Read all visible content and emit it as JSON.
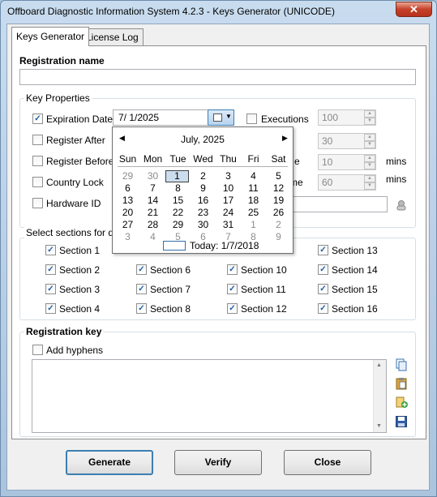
{
  "window": {
    "title": "Offboard Diagnostic Information System 4.2.3 - Keys Generator (UNICODE)",
    "close_glyph": "✕"
  },
  "tabs": [
    {
      "label": "Keys Generator",
      "selected": true
    },
    {
      "label": "License Log",
      "selected": false
    }
  ],
  "registration_name": {
    "label": "Registration name",
    "value": ""
  },
  "key_properties": {
    "title": "Key Properties",
    "expiration_date": {
      "label": "Expiration Date",
      "checked": true,
      "value": "7/  1/2025"
    },
    "register_after": {
      "label": "Register After",
      "checked": false
    },
    "register_before": {
      "label": "Register Before",
      "checked": false
    },
    "country_lock": {
      "label": "Country Lock",
      "checked": false
    },
    "hardware_id": {
      "label": "Hardware ID",
      "checked": false,
      "value": ""
    },
    "executions": {
      "label": "Executions",
      "checked": false,
      "value": "100"
    },
    "field_2": {
      "value": "30"
    },
    "field_3": {
      "partial_label": "e",
      "value": "10",
      "unit": "mins"
    },
    "field_4": {
      "partial_label": "me",
      "value": "60",
      "unit": "mins"
    }
  },
  "calendar": {
    "month_label": "July, 2025",
    "prev_glyph": "◀",
    "next_glyph": "▶",
    "days_of_week": [
      "Sun",
      "Mon",
      "Tue",
      "Wed",
      "Thu",
      "Fri",
      "Sat"
    ],
    "weeks": [
      [
        "29",
        "30",
        "1",
        "2",
        "3",
        "4",
        "5"
      ],
      [
        "6",
        "7",
        "8",
        "9",
        "10",
        "11",
        "12"
      ],
      [
        "13",
        "14",
        "15",
        "16",
        "17",
        "18",
        "19"
      ],
      [
        "20",
        "21",
        "22",
        "23",
        "24",
        "25",
        "26"
      ],
      [
        "27",
        "28",
        "29",
        "30",
        "31",
        "1",
        "2"
      ],
      [
        "3",
        "4",
        "5",
        "6",
        "7",
        "8",
        "9"
      ]
    ],
    "today_label": "Today: 1/7/2018"
  },
  "sections": {
    "title": "Select sections for dec",
    "items": [
      {
        "label": "Section 1",
        "checked": true
      },
      {
        "label": "Section 2",
        "checked": true
      },
      {
        "label": "Section 3",
        "checked": true
      },
      {
        "label": "Section 4",
        "checked": true
      },
      {
        "label": "Section 6",
        "checked": true
      },
      {
        "label": "Section 7",
        "checked": true
      },
      {
        "label": "Section 8",
        "checked": true
      },
      {
        "label": "Section 10",
        "checked": true
      },
      {
        "label": "Section 11",
        "checked": true
      },
      {
        "label": "Section 12",
        "checked": true
      },
      {
        "label": "Section 13",
        "checked": true
      },
      {
        "label": "Section 14",
        "checked": true
      },
      {
        "label": "Section 15",
        "checked": true
      },
      {
        "label": "Section 16",
        "checked": true
      }
    ]
  },
  "registration_key": {
    "title": "Registration key",
    "add_hyphens": {
      "label": "Add hyphens",
      "checked": false
    },
    "value": ""
  },
  "buttons": {
    "generate": "Generate",
    "verify": "Verify",
    "close": "Close"
  },
  "colors": {
    "accent": "#3c7fb1",
    "title_bar": "#c9dcef",
    "close_button": "#c5412a"
  }
}
